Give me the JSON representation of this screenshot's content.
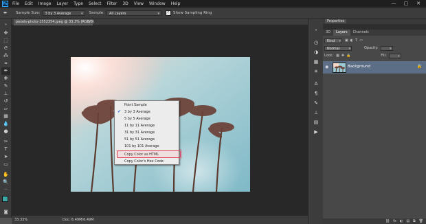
{
  "menu": {
    "logo": "Ps",
    "items": [
      "File",
      "Edit",
      "Image",
      "Layer",
      "Type",
      "Select",
      "Filter",
      "3D",
      "View",
      "Window",
      "Help"
    ],
    "window_controls": [
      "—",
      "▢",
      "✕"
    ]
  },
  "options": {
    "sample_size_label": "Sample Size:",
    "sample_size_value": "3 by 3 Average",
    "sample_label": "Sample:",
    "sample_value": "All Layers",
    "show_ring_label": "Show Sampling Ring"
  },
  "document": {
    "tab_title": "pexels-photo-1552354.jpeg @ 33.3% (RGB/8)",
    "tab_close": "×",
    "zoom": "33.33%",
    "doc_info": "Doc: 6.49M/6.49M"
  },
  "context_menu": {
    "items": [
      {
        "label": "Point Sample",
        "checked": false
      },
      {
        "label": "3 by 3 Average",
        "checked": true
      },
      {
        "label": "5 by 5 Average",
        "checked": false
      },
      {
        "label": "11 by 11 Average",
        "checked": false
      },
      {
        "label": "31 by 31 Average",
        "checked": false
      },
      {
        "label": "51 by 51 Average",
        "checked": false
      },
      {
        "label": "101 by 101 Average",
        "checked": false
      },
      {
        "label": "Copy Color as HTML",
        "checked": false
      },
      {
        "label": "Copy Color's Hex Code",
        "checked": false
      }
    ],
    "checkmark": "✔"
  },
  "panel": {
    "header_title": "Properties",
    "tabs": [
      "3D",
      "Layers",
      "Channels"
    ],
    "active_tab": "Layers",
    "kind_label": "Kind",
    "blend_mode": "Normal",
    "opacity_label": "Opacity:",
    "lock_label": "Lock:",
    "fill_label": "Fill:",
    "layer_name": "Background",
    "bottom_icons": [
      "fx",
      "◐",
      "▤",
      "⧉",
      "🗑"
    ]
  },
  "colors": {
    "accent_highlight": "#e03a4a",
    "selected_layer": "#5c6d86",
    "chrome_dark": "#3c3c3c",
    "canvas_bg": "#282828"
  }
}
